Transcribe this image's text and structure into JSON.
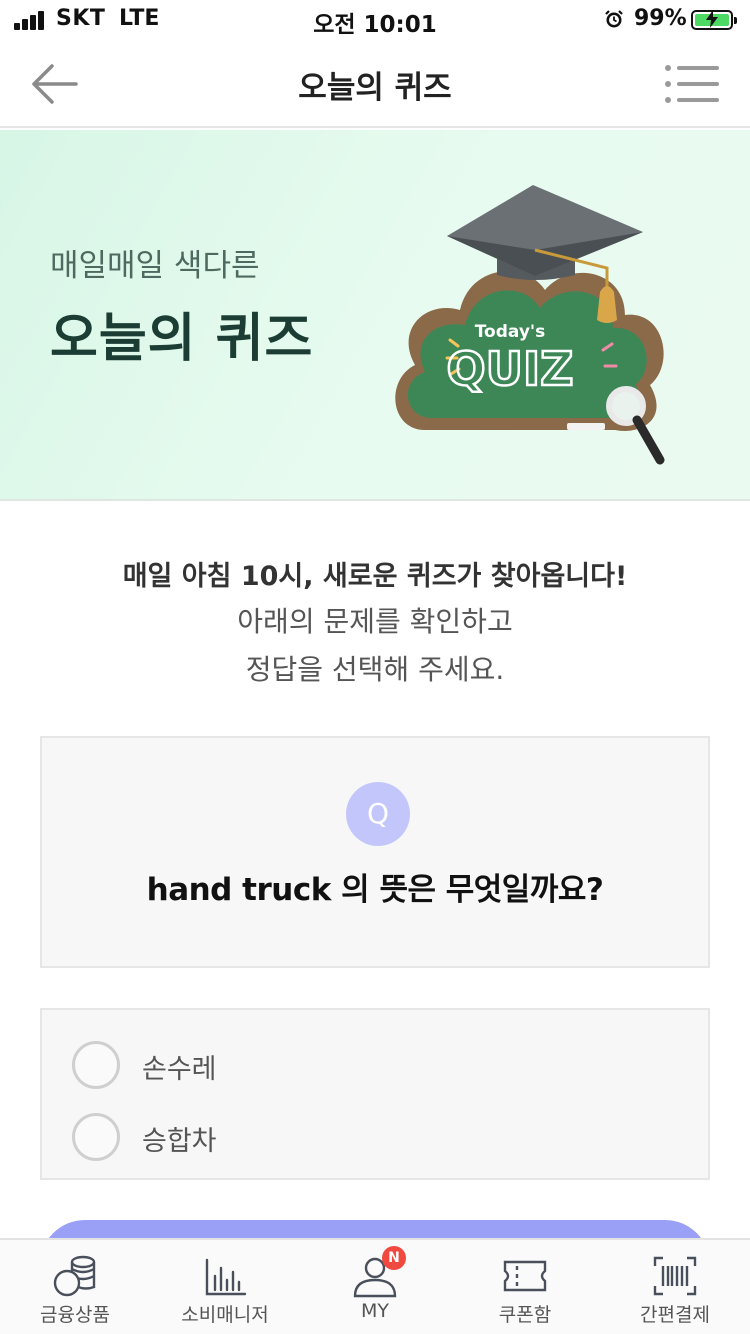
{
  "status_bar": {
    "carrier": "SKT",
    "network": "LTE",
    "time": "오전 10:01",
    "battery_percent": "99%",
    "battery_level": 0.99,
    "signal_icon": "signal-bars-icon",
    "alarm_icon": "alarm-clock-icon",
    "battery_icon": "battery-charging-icon"
  },
  "header": {
    "title": "오늘의 퀴즈",
    "back_icon": "arrow-left-icon",
    "menu_icon": "list-menu-icon"
  },
  "banner": {
    "subtitle": "매일매일 색다른",
    "title": "오늘의 퀴즈",
    "art_small_text": "Today's",
    "art_big_text": "QUIZ",
    "colors": {
      "background": "#e3f8ec",
      "board": "#3d8757",
      "frame": "#8b6a4a"
    }
  },
  "intro": {
    "line1": "매일 아침 10시, 새로운 퀴즈가 찾아옵니다!",
    "line2": "아래의 문제를 확인하고",
    "line3": "정답을 선택해 주세요."
  },
  "question": {
    "badge": "Q",
    "text": "hand truck 의 뜻은 무엇일까요?",
    "badge_color": "#c2c6fb"
  },
  "options": [
    {
      "label": "손수레",
      "selected": false
    },
    {
      "label": "승합차",
      "selected": false
    }
  ],
  "submit": {
    "color": "#9aa0f5"
  },
  "tab_bar": {
    "tabs": [
      {
        "label": "금융상품",
        "icon": "coins-icon"
      },
      {
        "label": "소비매니저",
        "icon": "bar-chart-icon"
      },
      {
        "label": "MY",
        "icon": "person-icon",
        "badge": "N"
      },
      {
        "label": "쿠폰함",
        "icon": "ticket-icon"
      },
      {
        "label": "간편결제",
        "icon": "barcode-icon"
      }
    ]
  }
}
